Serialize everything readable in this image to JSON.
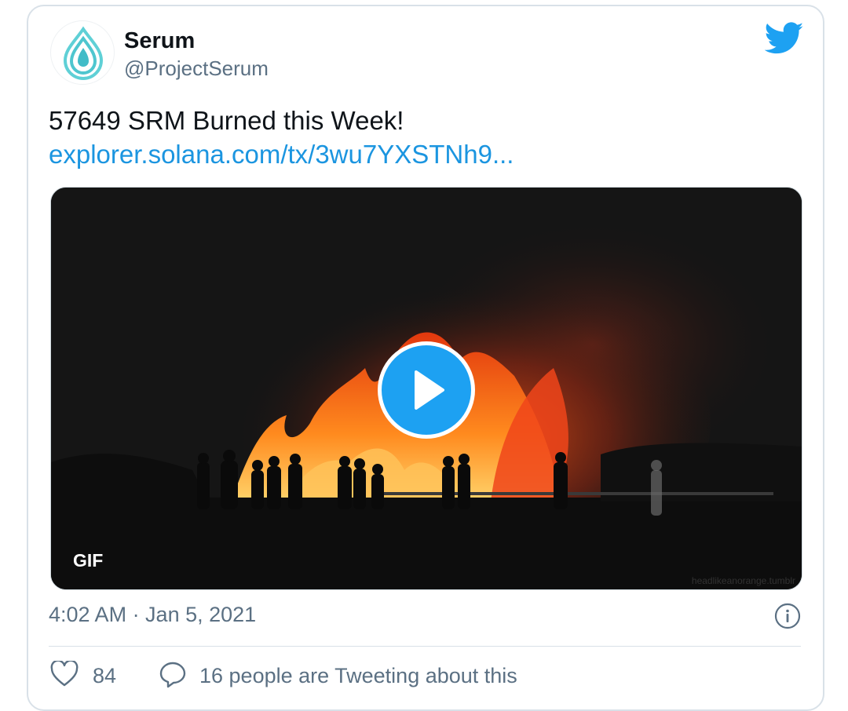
{
  "tweet": {
    "author": {
      "name": "Serum",
      "handle": "@ProjectSerum",
      "avatar_icon": "serum-drop-logo"
    },
    "text": "57649 SRM Burned this Week!",
    "link": "explorer.solana.com/tx/3wu7YXSTNh9...",
    "media": {
      "type": "gif",
      "badge": "GIF",
      "play_icon": "play-icon",
      "watermark": "headlikeanorange.tumblr"
    },
    "timestamp": "4:02 AM · Jan 5, 2021",
    "stats": {
      "likes": "84",
      "conversation": "16 people are Tweeting about this"
    }
  },
  "colors": {
    "accent": "#1da1f2",
    "link": "#1b95e0",
    "text_primary": "#0f1419",
    "text_secondary": "#5b7083",
    "border": "#d9e1e8"
  },
  "icons": {
    "platform": "twitter-bird-icon",
    "info": "info-icon",
    "like": "heart-icon",
    "reply": "speech-bubble-icon"
  }
}
